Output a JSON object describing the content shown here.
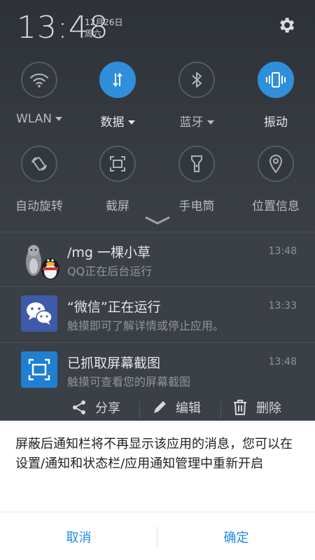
{
  "status": {
    "time": "13:48",
    "date": "12月26日",
    "weekday": "周六"
  },
  "toggles": [
    {
      "label": "WLAN",
      "icon": "wifi-icon",
      "active": false,
      "dropdown": true
    },
    {
      "label": "数据",
      "icon": "data-arrows-icon",
      "active": true,
      "dropdown": true
    },
    {
      "label": "蓝牙",
      "icon": "bluetooth-icon",
      "active": false,
      "dropdown": true
    },
    {
      "label": "振动",
      "icon": "vibrate-icon",
      "active": true,
      "dropdown": false
    },
    {
      "label": "自动旋转",
      "icon": "auto-rotate-icon",
      "active": false,
      "dropdown": false
    },
    {
      "label": "截屏",
      "icon": "screenshot-icon",
      "active": false,
      "dropdown": false
    },
    {
      "label": "手电筒",
      "icon": "flashlight-icon",
      "active": false,
      "dropdown": false
    },
    {
      "label": "位置信息",
      "icon": "location-icon",
      "active": false,
      "dropdown": false
    }
  ],
  "notifications": [
    {
      "title": "/mg 一棵小草",
      "subtitle": "QQ正在后台运行",
      "time": "13:48",
      "icon": "qq-icon"
    },
    {
      "title": "“微信”正在运行",
      "subtitle": "触摸即可了解详情或停止应用。",
      "time": "13:33",
      "icon": "wechat-icon"
    },
    {
      "title": "已抓取屏幕截图",
      "subtitle": "触摸可查看您的屏幕截图",
      "time": "13:48",
      "icon": "screenshot-icon"
    }
  ],
  "actions": {
    "share": "分享",
    "edit": "编辑",
    "delete": "删除"
  },
  "dialog": {
    "message": "屏蔽后通知栏将不再显示该应用的消息，您可以在设置/通知和状态栏/应用通知管理中重新开启",
    "cancel": "取消",
    "confirm": "确定"
  },
  "colors": {
    "accent": "#2f8fdb",
    "dialog_button": "#1e88e5"
  }
}
